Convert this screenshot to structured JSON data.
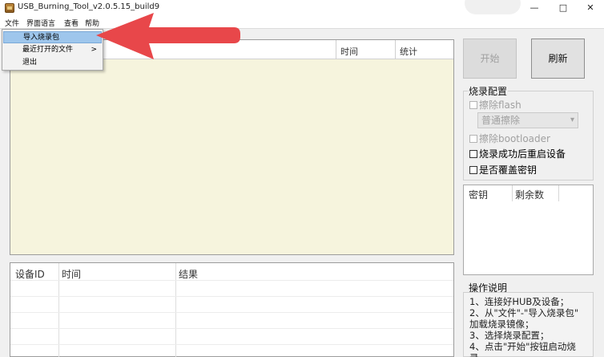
{
  "window": {
    "title": "USB_Burning_Tool_v2.0.5.15_build9",
    "controls": {
      "minimize": "—",
      "maximize": "□",
      "close": "✕"
    }
  },
  "menubar": [
    "文件",
    "界面语言",
    "查看",
    "帮助"
  ],
  "file_menu": [
    {
      "label": "导入烧录包",
      "highlighted": true
    },
    {
      "label": "最近打开的文件",
      "submenu_arrow": ">"
    },
    {
      "label": "退出"
    }
  ],
  "annotation": {
    "arrow_color": "#e8474a"
  },
  "log_table": {
    "columns": [
      "时间",
      "统计"
    ]
  },
  "results_table": {
    "columns": [
      "设备ID",
      "时间",
      "结果"
    ]
  },
  "buttons": {
    "start": "开始",
    "refresh": "刷新"
  },
  "burn_config": {
    "label": "烧录配置",
    "erase_flash": "擦除flash",
    "erase_mode": "普通擦除",
    "erase_bootloader": "擦除bootloader",
    "reboot_after": "烧录成功后重启设备",
    "overwrite_key": "是否覆盖密钥"
  },
  "key_table": {
    "columns": [
      "密钥",
      "剩余数"
    ]
  },
  "instructions": {
    "label": "操作说明",
    "lines": [
      "1、连接好HUB及设备；",
      "2、从\"文件\"-\"导入烧录包\"",
      "加载烧录镜像；",
      "3、选择烧录配置；",
      "4、点击\"开始\"按钮启动烧",
      "录"
    ]
  },
  "colors": {
    "log_background": "#f6f4dd",
    "highlight": "#9ec6ec"
  }
}
